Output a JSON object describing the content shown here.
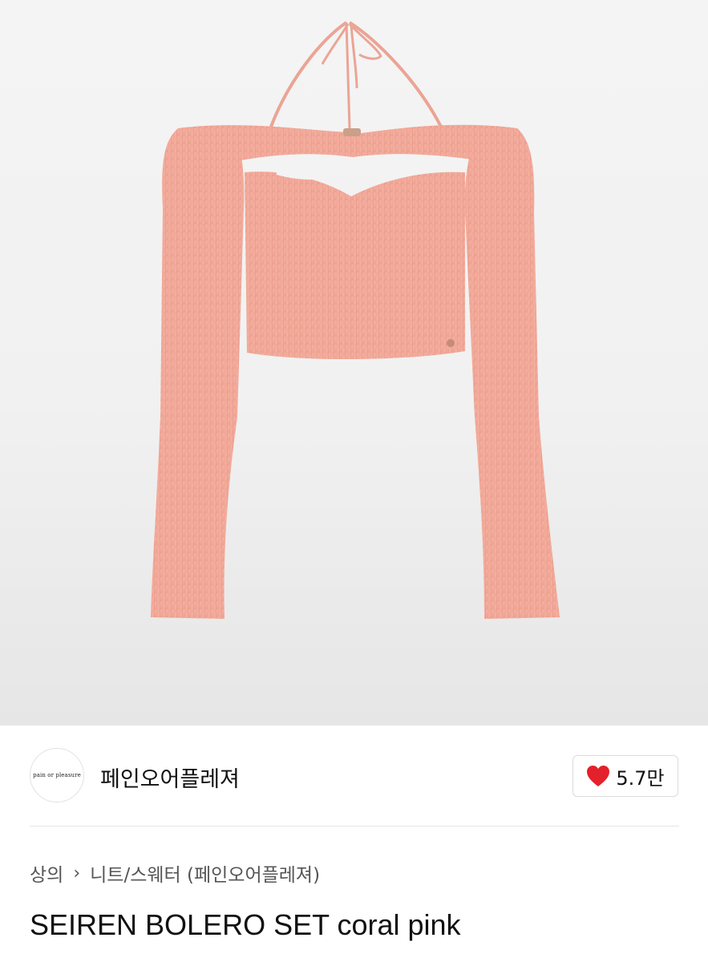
{
  "product_image": {
    "alt": "SEIREN BOLERO SET coral pink",
    "garment_color": "#f0a595",
    "background_color": "#f2f2f2"
  },
  "brand": {
    "logo_text": "pain or pleasure",
    "name": "페인오어플레져"
  },
  "like": {
    "icon": "heart-icon",
    "icon_color": "#e4202b",
    "count": "5.7만"
  },
  "breadcrumb": {
    "category": "상의",
    "separator_icon": "chevron-right-icon",
    "subcategory": "니트/스웨터 (페인오어플레져)"
  },
  "product": {
    "title": "SEIREN BOLERO SET coral pink"
  }
}
